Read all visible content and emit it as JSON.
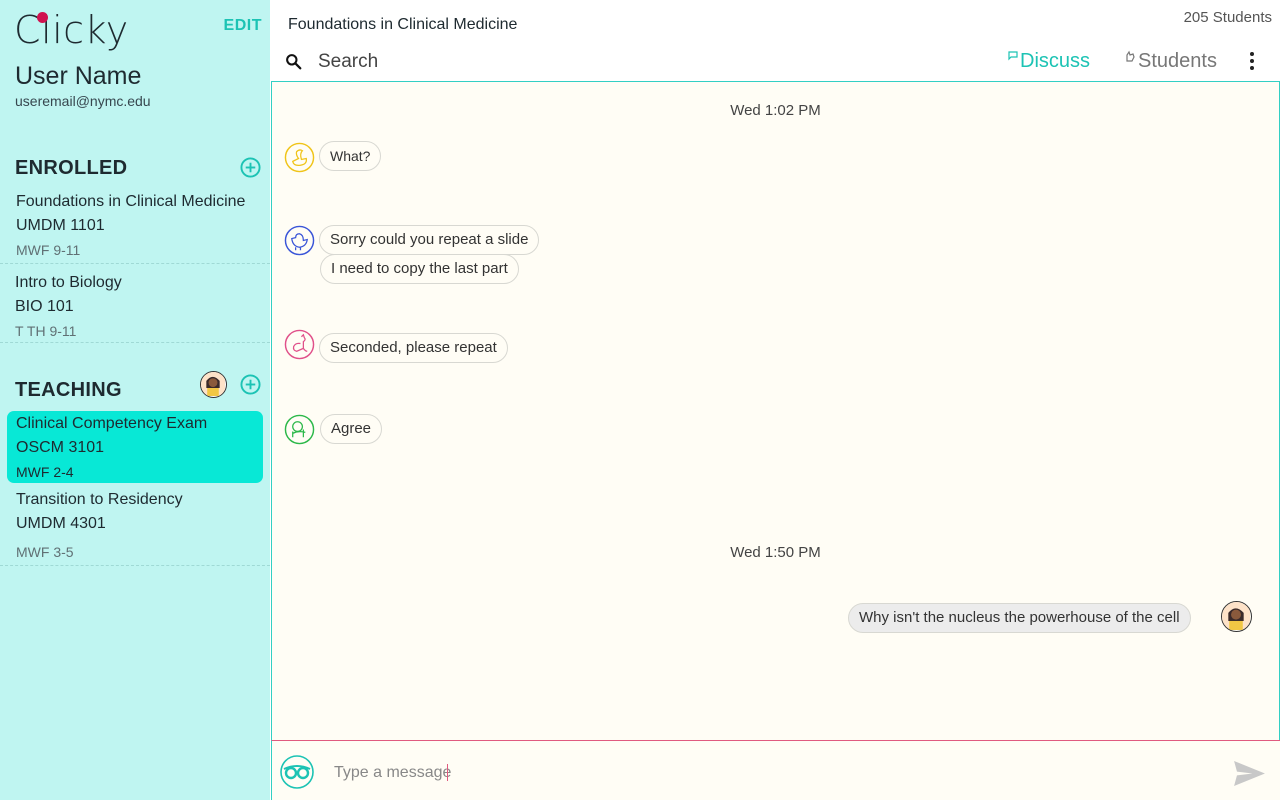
{
  "app": {
    "logo_text": "Clicky",
    "edit_label": "EDIT"
  },
  "user": {
    "name": "User Name",
    "email": "useremail@nymc.edu"
  },
  "sidebar": {
    "enrolled_label": "ENROLLED",
    "teaching_label": "TEACHING",
    "enrolled": [
      {
        "title": "Foundations in Clinical Medicine",
        "code": "UMDM 1101",
        "time": "MWF 9-11"
      },
      {
        "title": "Intro to Biology",
        "code": "BIO 101",
        "time": "T TH 9-11"
      }
    ],
    "teaching": [
      {
        "title": "Clinical Competency Exam",
        "code": "OSCM 3101",
        "time": "MWF 2-4",
        "active": true
      },
      {
        "title": "Transition to Residency",
        "code": "UMDM 4301",
        "time": "MWF 3-5"
      }
    ]
  },
  "header": {
    "course_title": "Foundations in Clinical Medicine",
    "student_count": "205 Students",
    "search_placeholder": "Search",
    "tabs": [
      {
        "label": "Discuss",
        "icon": "flag-icon",
        "active": true
      },
      {
        "label": "Students",
        "icon": "hand-icon",
        "active": false
      }
    ]
  },
  "chat": {
    "groups": [
      {
        "timestamp": "Wed 1:02 PM",
        "messages": [
          {
            "avatar": "duck-icon",
            "color": "#f0c419",
            "texts": [
              "What?"
            ]
          },
          {
            "avatar": "chicken-icon",
            "color": "#3a55d8",
            "texts": [
              "Sorry could you repeat a slide",
              "I need to copy the last part"
            ]
          },
          {
            "avatar": "kangaroo-icon",
            "color": "#e0508a",
            "texts": [
              "Seconded, please repeat"
            ]
          },
          {
            "avatar": "lion-icon",
            "color": "#2cb84a",
            "texts": [
              "Agree"
            ]
          }
        ]
      },
      {
        "timestamp": "Wed 1:50 PM",
        "messages": [
          {
            "avatar": "user-avatar",
            "mine": true,
            "texts": [
              "Why isn't the nucleus the powerhouse of the cell"
            ]
          }
        ]
      }
    ]
  },
  "composer": {
    "placeholder": "Type a message"
  },
  "colors": {
    "accent": "#1cc3b4",
    "sidebar_bg": "#bff5f1",
    "active_course": "#08e8d6",
    "chat_bg": "#fffdf5",
    "composer_border": "#e05a7f"
  }
}
